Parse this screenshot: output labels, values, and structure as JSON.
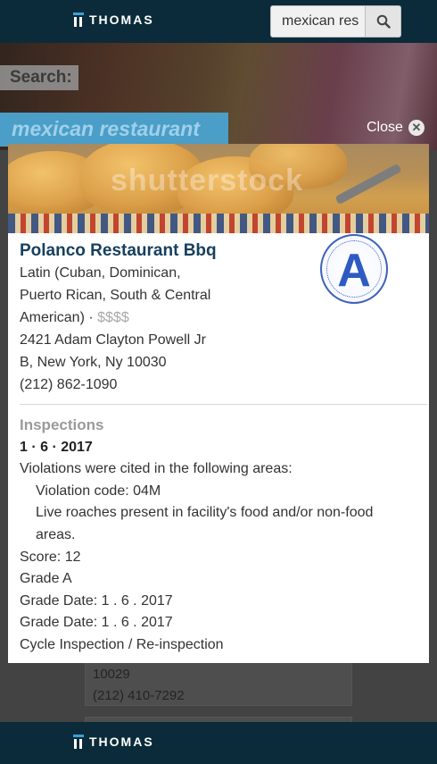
{
  "header": {
    "brand": "THOMAS",
    "search_value": "mexican res"
  },
  "page": {
    "search_label": "Search:",
    "query": "mexican restaurant"
  },
  "modal": {
    "close_label": "Close",
    "image_watermark": "shutterstock",
    "restaurant": {
      "name": "Polanco Restaurant Bbq",
      "cuisine_line1": "Latin (Cuban, Dominican,",
      "cuisine_line2": "Puerto Rican, South & Central",
      "cuisine_line3": "American) ·",
      "price": "$$$$",
      "address_line1": "2421 Adam Clayton Powell Jr",
      "address_line2": "B, New York, Ny 10030",
      "phone": "(212) 862-1090",
      "grade": "A"
    },
    "inspection": {
      "title": "Inspections",
      "date": "1 · 6 · 2017",
      "intro": "Violations were cited in the following areas:",
      "violation_code": "Violation code: 04M",
      "violation_desc_line1": "Live roaches present in facility's food and/or non-food",
      "violation_desc_line2": "areas.",
      "score": "Score: 12",
      "grade": "Grade A",
      "grade_date_1": "Grade Date: 1 . 6 . 2017",
      "grade_date_2": "Grade Date: 1 . 6 . 2017",
      "type": "Cycle Inspection / Re-inspection"
    }
  },
  "background_list": {
    "line1": "10029",
    "line2": "(212) 410-7292"
  },
  "footer": {
    "brand": "THOMAS"
  },
  "colors": {
    "nav_bg": "#0b2b3a",
    "name": "#17405e",
    "query_banner": "#4a9ec8",
    "grade_badge": "#2e5bc2"
  }
}
